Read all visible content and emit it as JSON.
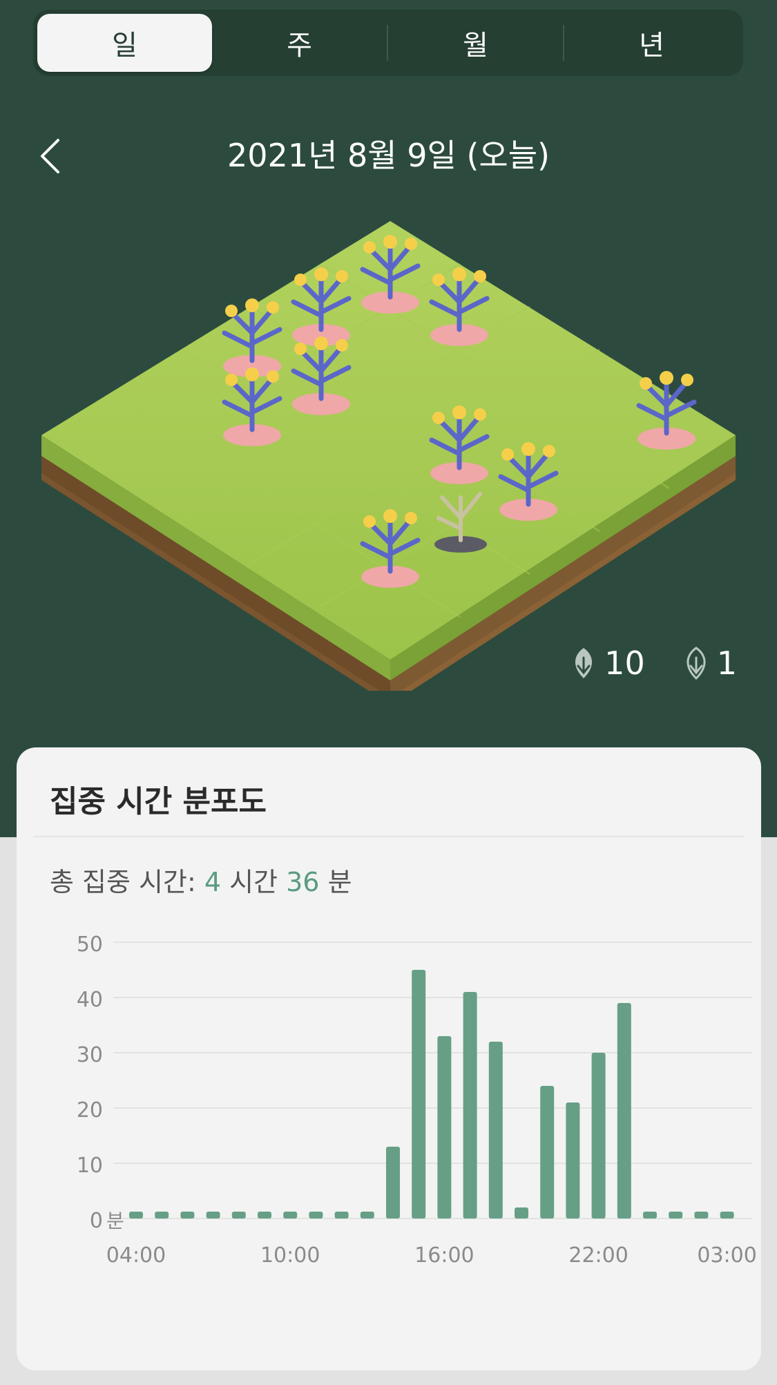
{
  "tabs": [
    "일",
    "주",
    "월",
    "년"
  ],
  "active_tab": 0,
  "header": {
    "date_title": "2021년 8월 9일 (오늘)"
  },
  "counts": {
    "healthy": "10",
    "withered": "1"
  },
  "card": {
    "title": "집중 시간 분포도",
    "total_label": "총 집중 시간: ",
    "total_hours": "4",
    "hours_unit": " 시간 ",
    "total_minutes": "36",
    "minutes_unit": " 분"
  },
  "colors": {
    "bg": "#2c4b3e",
    "accent": "#5a9b80",
    "bar": "#669f85"
  },
  "chart_data": {
    "type": "bar",
    "ylabel": "",
    "xlabel": "",
    "yunit": "분",
    "ylim": [
      0,
      50
    ],
    "yticks": [
      0,
      10,
      20,
      30,
      40,
      50
    ],
    "xtick_labels": [
      {
        "index": 0,
        "label": "04:00"
      },
      {
        "index": 6,
        "label": "10:00"
      },
      {
        "index": 12,
        "label": "16:00"
      },
      {
        "index": 18,
        "label": "22:00"
      },
      {
        "index": 23,
        "label": "03:00"
      }
    ],
    "categories": [
      "04",
      "05",
      "06",
      "07",
      "08",
      "09",
      "10",
      "11",
      "12",
      "13",
      "14",
      "15",
      "16",
      "17",
      "18",
      "19",
      "20",
      "21",
      "22",
      "23",
      "00",
      "01",
      "02",
      "03"
    ],
    "values": [
      0,
      0,
      0,
      0,
      0,
      0,
      0,
      0,
      0,
      0,
      13,
      45,
      33,
      41,
      32,
      2,
      24,
      21,
      30,
      39,
      0,
      0,
      0,
      0
    ],
    "grid": true
  }
}
